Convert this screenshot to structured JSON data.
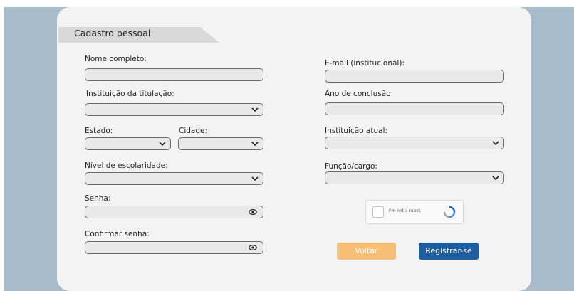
{
  "section_title": "Cadastro pessoal",
  "left_column": {
    "nome_label": "Nome completo:",
    "instituicao_titulacao_label": "Instituição da titulação:",
    "estado_label": "Estado:",
    "cidade_label": "Cidade:",
    "escolaridade_label": "Nível de escolaridade:",
    "senha_label": "Senha:",
    "confirmar_label": "Confirmar senha:"
  },
  "right_column": {
    "email_label": "E-mail (institucional):",
    "ano_label": "Ano de conclusão:",
    "instituicao_atual_label": "Instituição atual:",
    "funcao_label": "Função/cargo:"
  },
  "captcha": {
    "text": "I'm not a robot"
  },
  "buttons": {
    "back": "Voltar",
    "register": "Registrar-se"
  },
  "colors": {
    "background_panel": "#a7bccb",
    "card": "#f3f3f3",
    "back_button": "#f7be77",
    "register_button": "#1c5e9e"
  },
  "icons": {
    "dropdown": "chevron-down-icon",
    "password_toggle": "eye-icon",
    "captcha_logo": "recaptcha-icon"
  }
}
